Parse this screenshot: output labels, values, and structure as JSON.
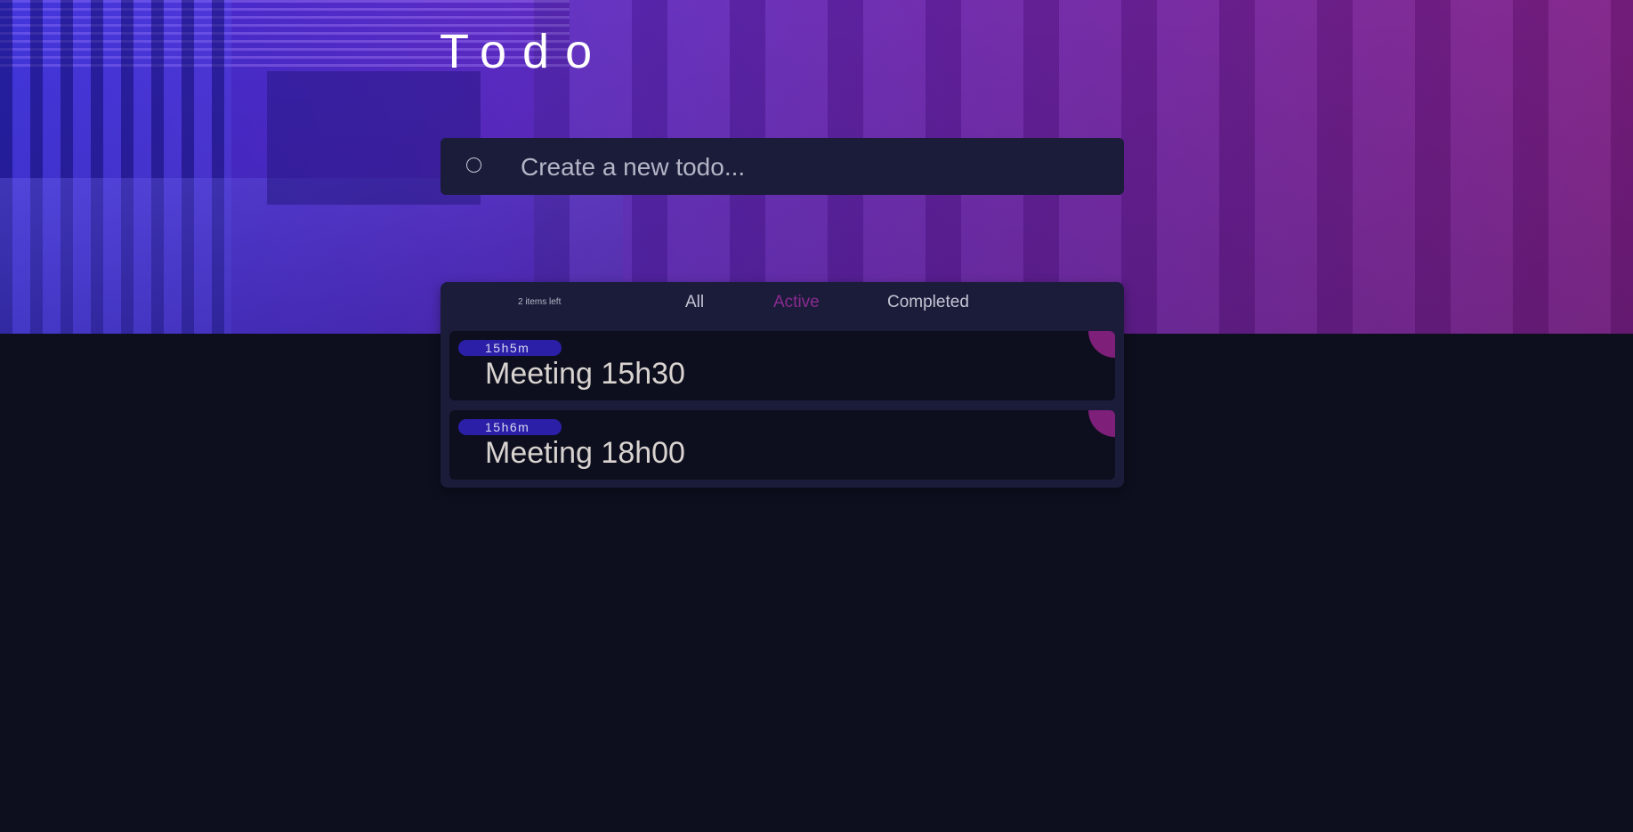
{
  "app": {
    "title": "Todo"
  },
  "new_todo": {
    "placeholder": "Create a new todo..."
  },
  "footer": {
    "items_left": "2 items left",
    "filters": [
      {
        "label": "All",
        "active": false
      },
      {
        "label": "Active",
        "active": true
      },
      {
        "label": "Completed",
        "active": false
      }
    ]
  },
  "todos": [
    {
      "time": "15h5m",
      "text": "Meeting 15h30"
    },
    {
      "time": "15h6m",
      "text": "Meeting 18h00"
    }
  ],
  "colors": {
    "background": "#0d0f1e",
    "panel": "#1b1c3a",
    "accent": "#8a2a8e",
    "badge": "#2b1fa8",
    "corner_tag": "#7e1f7a"
  },
  "icons": {
    "new_todo_toggle": "circle-icon",
    "todo_corner": "corner-tag-icon"
  }
}
